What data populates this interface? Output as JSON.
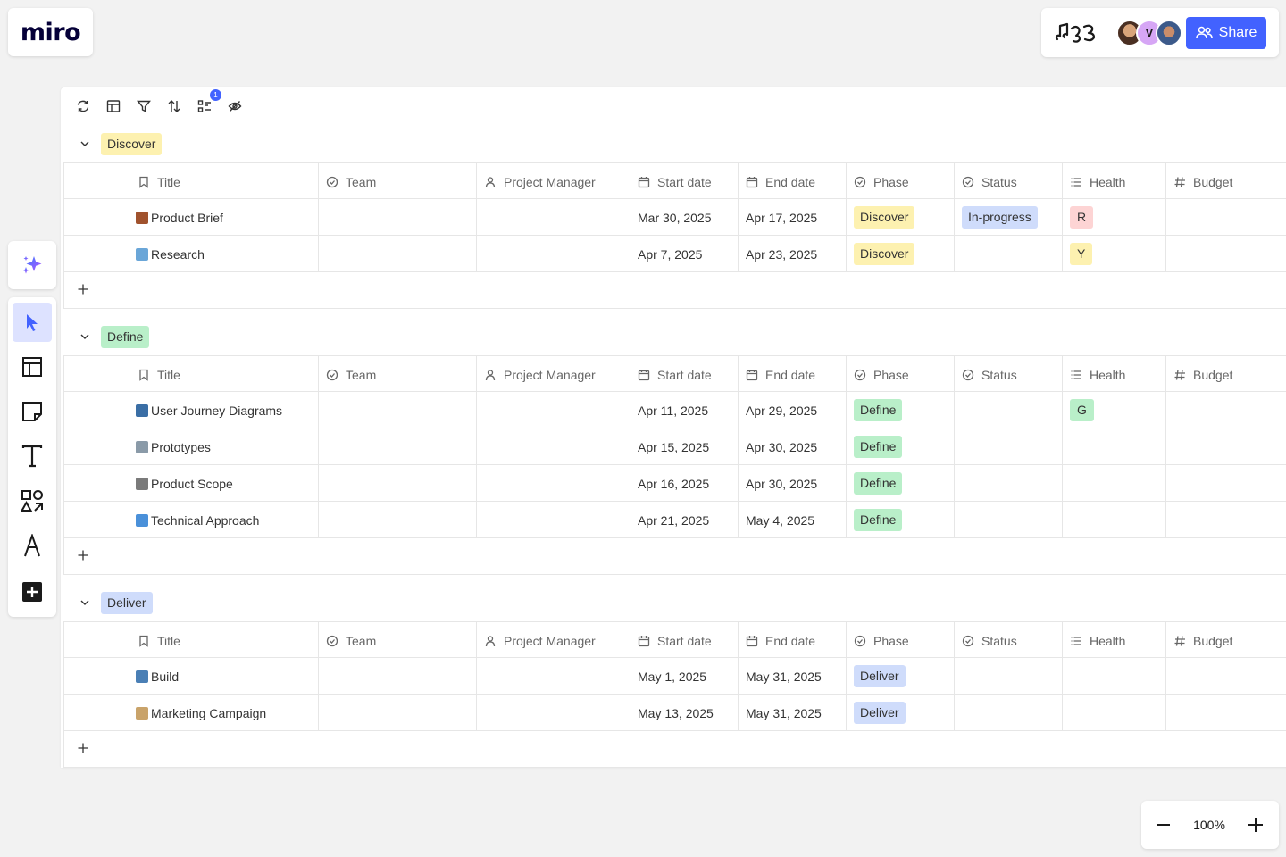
{
  "app": {
    "logo": "miro"
  },
  "collab": {
    "avatars": [
      {
        "name": "user-avatar-1",
        "initial": ""
      },
      {
        "name": "user-avatar-v",
        "initial": "V"
      },
      {
        "name": "user-avatar-3",
        "initial": ""
      }
    ],
    "share_label": "Share"
  },
  "zoom": {
    "level": "100%"
  },
  "columns": [
    "Title",
    "Team",
    "Project Manager",
    "Start date",
    "End date",
    "Phase",
    "Status",
    "Health",
    "Budget"
  ],
  "colors": {
    "discover": "#fdf1b0",
    "define": "#b9efc9",
    "deliver": "#cfdcfb",
    "status_inprogress": "#cfdcfb",
    "health_r": "#fdd4d4",
    "health_y": "#fdf1b0",
    "health_g": "#b9efc9",
    "accent": "#4262ff"
  },
  "groups": [
    {
      "label": "Discover",
      "key": "discover",
      "rows": [
        {
          "icon": "briefcase-icon",
          "title": "Product Brief",
          "team": "",
          "pm": "",
          "start": "Mar 30, 2025",
          "end": "Apr 17, 2025",
          "phase": "Discover",
          "status": "In-progress",
          "health": "R",
          "budget": ""
        },
        {
          "icon": "magnifier-icon",
          "title": "Research",
          "team": "",
          "pm": "",
          "start": "Apr 7, 2025",
          "end": "Apr 23, 2025",
          "phase": "Discover",
          "status": "",
          "health": "Y",
          "budget": ""
        }
      ]
    },
    {
      "label": "Define",
      "key": "define",
      "rows": [
        {
          "icon": "people-icon",
          "title": "User Journey Diagrams",
          "team": "",
          "pm": "",
          "start": "Apr 11, 2025",
          "end": "Apr 29, 2025",
          "phase": "Define",
          "status": "",
          "health": "G",
          "budget": ""
        },
        {
          "icon": "jar-icon",
          "title": "Prototypes",
          "team": "",
          "pm": "",
          "start": "Apr 15, 2025",
          "end": "Apr 30, 2025",
          "phase": "Define",
          "status": "",
          "health": "",
          "budget": ""
        },
        {
          "icon": "stethoscope-icon",
          "title": "Product Scope",
          "team": "",
          "pm": "",
          "start": "Apr 16, 2025",
          "end": "Apr 30, 2025",
          "phase": "Define",
          "status": "",
          "health": "",
          "budget": ""
        },
        {
          "icon": "monitor-icon",
          "title": "Technical Approach",
          "team": "",
          "pm": "",
          "start": "Apr 21, 2025",
          "end": "May 4, 2025",
          "phase": "Define",
          "status": "",
          "health": "",
          "budget": ""
        }
      ]
    },
    {
      "label": "Deliver",
      "key": "deliver",
      "rows": [
        {
          "icon": "laptop-icon",
          "title": "Build",
          "team": "",
          "pm": "",
          "start": "May 1, 2025",
          "end": "May 31, 2025",
          "phase": "Deliver",
          "status": "",
          "health": "",
          "budget": ""
        },
        {
          "icon": "clipboard-icon",
          "title": "Marketing Campaign",
          "team": "",
          "pm": "",
          "start": "May 13, 2025",
          "end": "May 31, 2025",
          "phase": "Deliver",
          "status": "",
          "health": "",
          "budget": ""
        }
      ]
    }
  ]
}
